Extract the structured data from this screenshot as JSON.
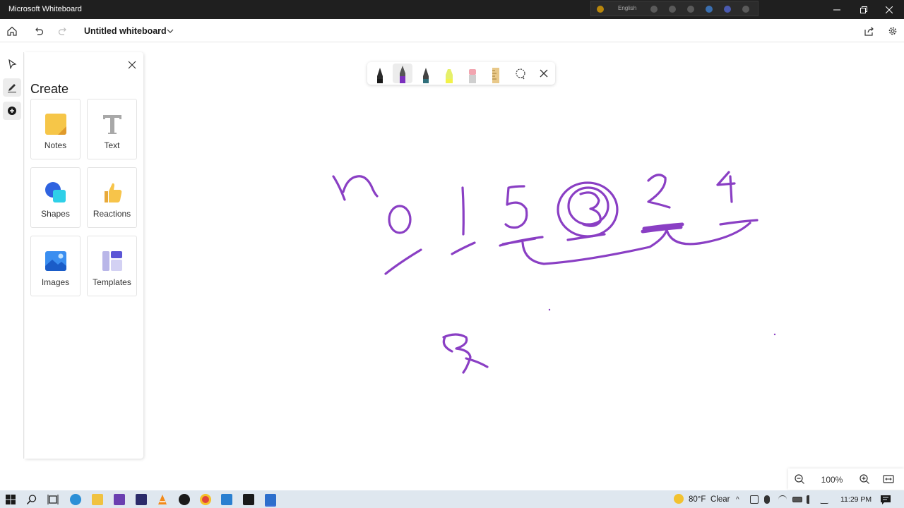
{
  "window": {
    "title": "Microsoft Whiteboard",
    "language": "English"
  },
  "appbar": {
    "whiteboard_title": "Untitled whiteboard"
  },
  "create_panel": {
    "heading": "Create",
    "tiles": [
      {
        "label": "Notes",
        "icon": "sticky-note-icon"
      },
      {
        "label": "Text",
        "icon": "text-icon"
      },
      {
        "label": "Shapes",
        "icon": "shapes-icon"
      },
      {
        "label": "Reactions",
        "icon": "thumbs-up-icon"
      },
      {
        "label": "Images",
        "icon": "image-icon"
      },
      {
        "label": "Templates",
        "icon": "templates-icon"
      }
    ]
  },
  "pen_toolbar": {
    "tools": [
      {
        "name": "black-pen",
        "color": "#1a1a1a"
      },
      {
        "name": "purple-pen",
        "color": "#7b2fbe",
        "selected": true
      },
      {
        "name": "teal-pen",
        "color": "#2f6f7a"
      },
      {
        "name": "highlighter",
        "color": "#f2f24a"
      },
      {
        "name": "eraser",
        "color": "#f2a5b0"
      },
      {
        "name": "ruler",
        "color": "#e8c889"
      }
    ]
  },
  "canvas": {
    "ink_color": "#8a3fc4"
  },
  "zoom": {
    "level": "100%"
  },
  "taskbar": {
    "weather": {
      "temp": "80°F",
      "condition": "Clear"
    },
    "time": "11:29 PM"
  },
  "colors": {
    "titlebar": "#1f1f1f",
    "taskbar": "#dfe7ef",
    "accent": "#8a3fc4"
  }
}
